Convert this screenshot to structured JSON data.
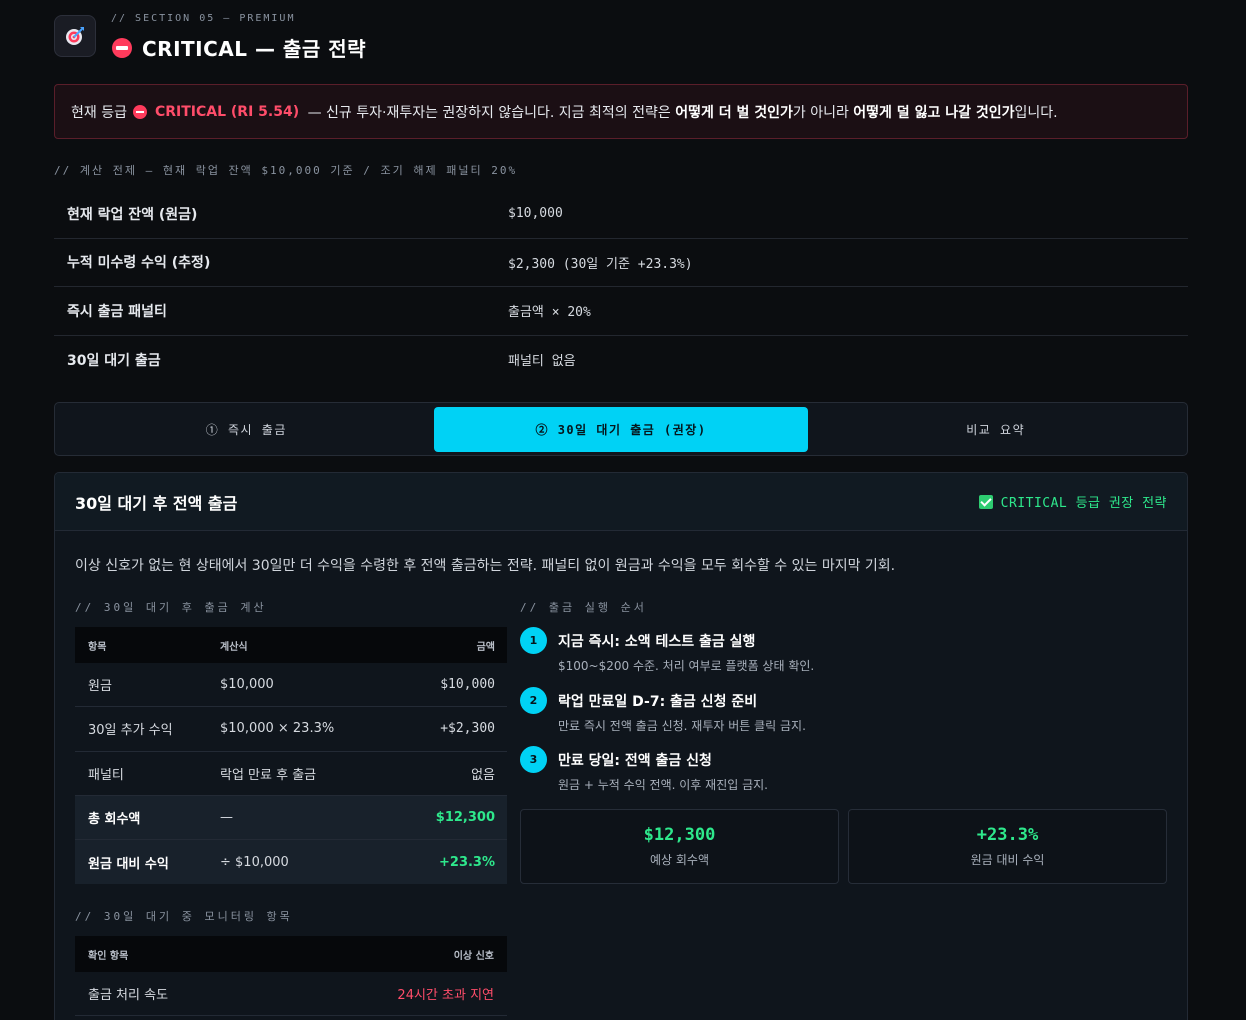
{
  "header": {
    "kicker": "// SECTION 05 — PREMIUM",
    "title": "CRITICAL — 출금 전략",
    "logo_icon": "target-icon"
  },
  "alert": {
    "prefix": "현재 등급",
    "grade": "CRITICAL (RI 5.54)",
    "text1": " — 신규 투자·재투자는 권장하지 않습니다. 지금 최적의 전략은 ",
    "bold1": "어떻게 더 벌 것인가",
    "text2": "가 아니라 ",
    "bold2": "어떻게 덜 잃고 나갈 것인가",
    "text3": "입니다."
  },
  "premise": "// 계산 전제 — 현재 락업 잔액 $10,000 기준 / 조기 해제 패널티 20%",
  "info_rows": [
    {
      "label": "현재 락업 잔액 (원금)",
      "value": "$10,000"
    },
    {
      "label": "누적 미수령 수익 (추정)",
      "value": "$2,300 (30일 기준 +23.3%)"
    },
    {
      "label": "즉시 출금 패널티",
      "value": "출금액 × 20%"
    },
    {
      "label": "30일 대기 출금",
      "value": "패널티 없음"
    }
  ],
  "tabs": [
    {
      "label": "① 즉시 출금",
      "active": false
    },
    {
      "label": "② 30일 대기 출금 (권장)",
      "active": true
    },
    {
      "label": "비교 요약",
      "active": false
    }
  ],
  "panel": {
    "title": "30일 대기 후 전액 출금",
    "badge": "CRITICAL 등급 권장 전략",
    "desc": "이상 신호가 없는 현 상태에서 30일만 더 수익을 수령한 후 전액 출금하는 전략. 패널티 없이 원금과 수익을 모두 회수할 수 있는 마지막 기회.",
    "calc_label": "// 30일 대기 후 출금 계산",
    "steps_label": "// 출금 실행 순서",
    "monitor_label": "// 30일 대기 중 모니터링 항목"
  },
  "calc_table": {
    "headers": [
      "항목",
      "계산식",
      "금액"
    ],
    "rows": [
      {
        "item": "원금",
        "formula": "$10,000",
        "amount": "$10,000"
      },
      {
        "item": "30일 추가 수익",
        "formula": "$10,000 × 23.3%",
        "amount": "+$2,300"
      },
      {
        "item": "패널티",
        "formula": "락업 만료 후 출금",
        "amount": "없음"
      },
      {
        "item": "총 회수액",
        "formula": "—",
        "amount": "$12,300"
      },
      {
        "item": "원금 대비 수익",
        "formula": "÷ $10,000",
        "amount": "+23.3%"
      }
    ]
  },
  "steps": [
    {
      "num": "1",
      "title": "지금 즉시: 소액 테스트 출금 실행",
      "sub": "$100~$200 수준. 처리 여부로 플랫폼 상태 확인."
    },
    {
      "num": "2",
      "title": "락업 만료일 D-7: 출금 신청 준비",
      "sub": "만료 즉시 전액 출금 신청. 재투자 버튼 클릭 금지."
    },
    {
      "num": "3",
      "title": "만료 당일: 전액 출금 신청",
      "sub": "원금 + 누적 수익 전액. 이후 재진입 금지."
    }
  ],
  "stats": [
    {
      "value": "$12,300",
      "label": "예상 회수액"
    },
    {
      "value": "+23.3%",
      "label": "원금 대비 수익"
    }
  ],
  "monitor_table": {
    "headers": [
      "확인 항목",
      "이상 신호"
    ],
    "rows": [
      {
        "item": "출금 처리 속도",
        "signal": "24시간 초과 지연"
      }
    ]
  },
  "colors": {
    "accent": "#00d2f5",
    "critical": "#ff3b5c",
    "success": "#2ee88c"
  }
}
